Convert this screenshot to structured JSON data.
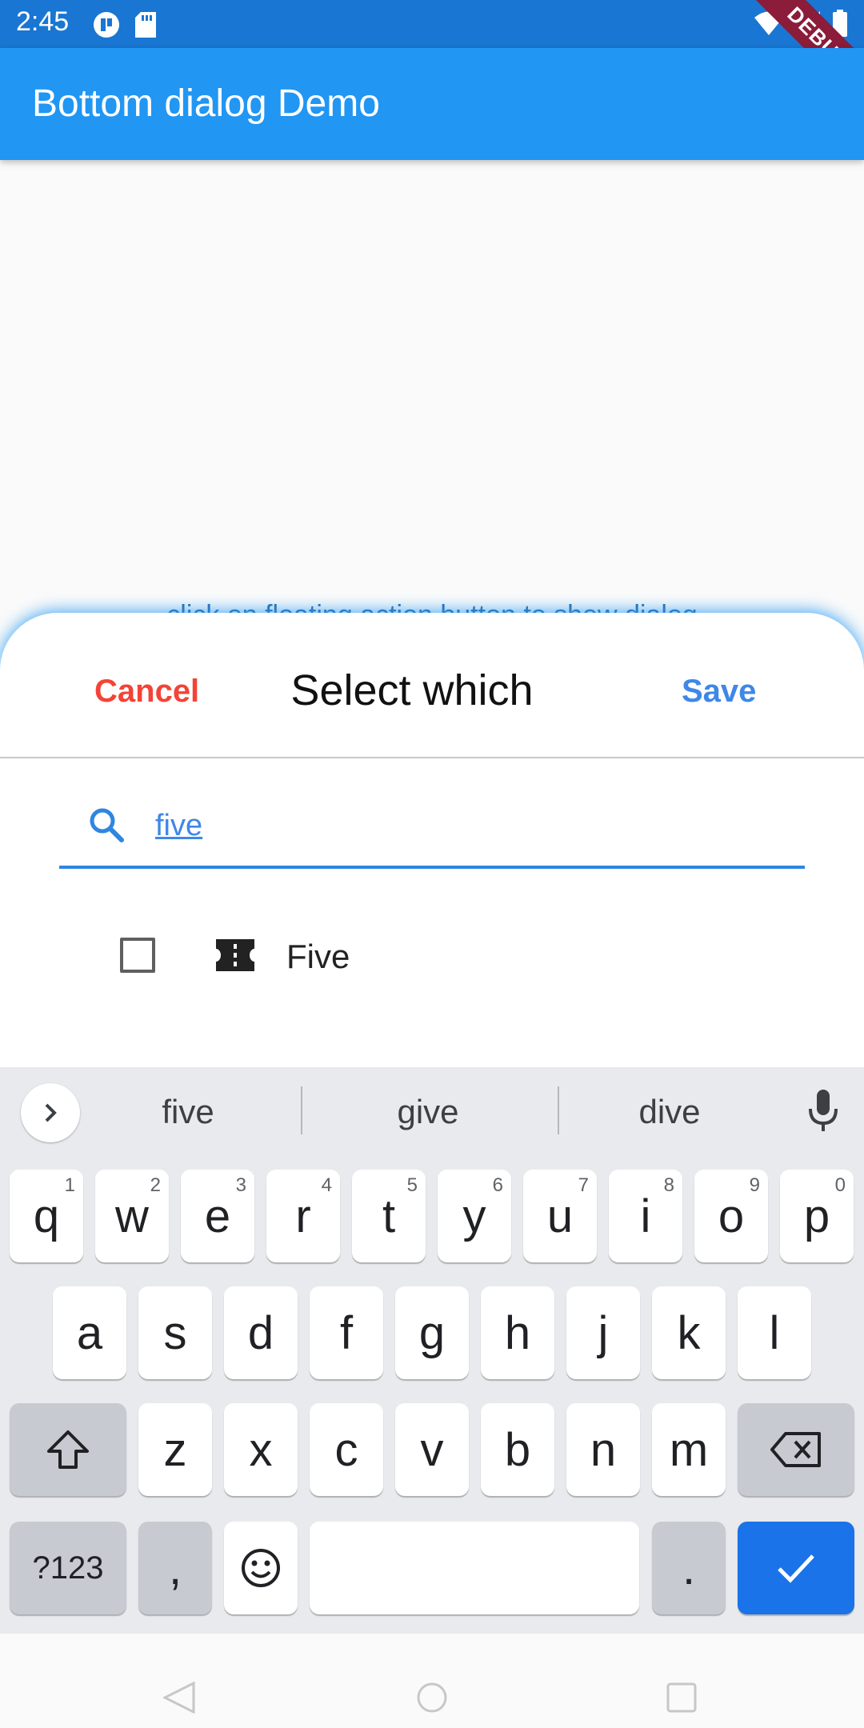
{
  "status_bar": {
    "time": "2:45",
    "debug_label": "DEBUG"
  },
  "app_bar": {
    "title": "Bottom dialog Demo"
  },
  "hint_text": "click on floating action button to show dialog",
  "sheet": {
    "cancel_label": "Cancel",
    "title": "Select which",
    "save_label": "Save",
    "search_value": "five",
    "items": [
      {
        "label": "Five",
        "checked": false
      }
    ]
  },
  "keyboard": {
    "suggestions": [
      "five",
      "give",
      "dive"
    ],
    "row1": [
      {
        "key": "q",
        "hint": "1"
      },
      {
        "key": "w",
        "hint": "2"
      },
      {
        "key": "e",
        "hint": "3"
      },
      {
        "key": "r",
        "hint": "4"
      },
      {
        "key": "t",
        "hint": "5"
      },
      {
        "key": "y",
        "hint": "6"
      },
      {
        "key": "u",
        "hint": "7"
      },
      {
        "key": "i",
        "hint": "8"
      },
      {
        "key": "o",
        "hint": "9"
      },
      {
        "key": "p",
        "hint": "0"
      }
    ],
    "row2": [
      "a",
      "s",
      "d",
      "f",
      "g",
      "h",
      "j",
      "k",
      "l"
    ],
    "row3": [
      "z",
      "x",
      "c",
      "v",
      "b",
      "n",
      "m"
    ],
    "symbols_label": "?123",
    "comma_label": ",",
    "period_label": "."
  },
  "colors": {
    "primary": "#2196f3",
    "status_bar": "#1976d2",
    "cancel": "#f44336",
    "save": "#3f87e8",
    "keyboard_enter": "#1a73e8"
  },
  "icons": {
    "search": "search-icon",
    "item": "ticket-icon",
    "mic": "mic-icon",
    "shift": "shift-icon",
    "backspace": "backspace-icon",
    "enter": "check-icon",
    "emoji": "emoji-icon"
  }
}
